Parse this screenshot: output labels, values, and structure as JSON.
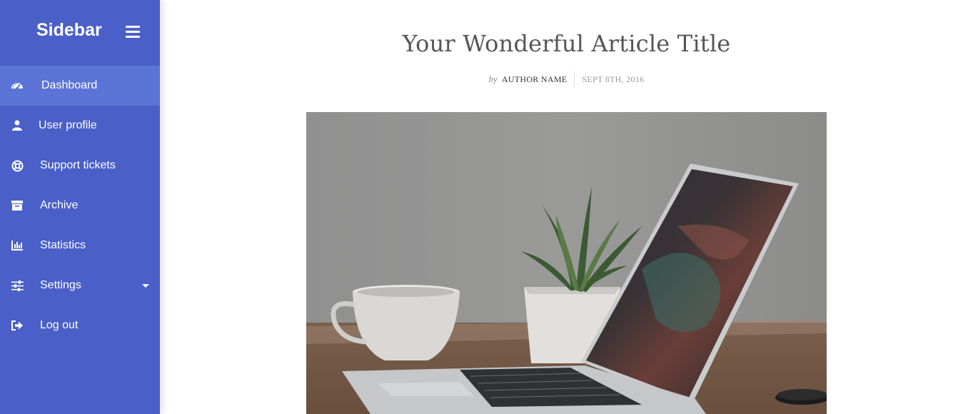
{
  "sidebar": {
    "brand": "Sidebar",
    "items": [
      {
        "label": "Dashboard",
        "icon": "dashboard-icon",
        "active": true
      },
      {
        "label": "User profile",
        "icon": "user-icon"
      },
      {
        "label": "Support tickets",
        "icon": "lifebuoy-icon"
      },
      {
        "label": "Archive",
        "icon": "archive-icon"
      },
      {
        "label": "Statistics",
        "icon": "bar-chart-icon"
      },
      {
        "label": "Settings",
        "icon": "sliders-icon",
        "has_dropdown": true
      },
      {
        "label": "Log out",
        "icon": "logout-icon"
      }
    ]
  },
  "article": {
    "title": "Your Wonderful Article Title",
    "by": "by",
    "author": "AUTHOR NAME",
    "date": "SEPT 8TH, 2016"
  },
  "colors": {
    "sidebar_bg": "#4a5fc7",
    "active_item_bg": "#5b74d6",
    "title_color": "#555555"
  }
}
